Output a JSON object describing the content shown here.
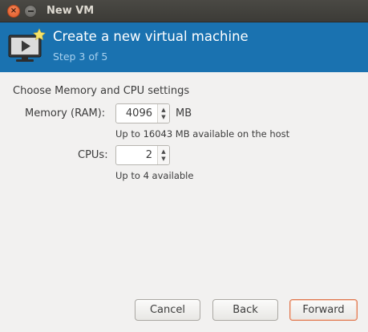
{
  "window": {
    "title": "New VM",
    "close_glyph": "×",
    "close_icon": "close-icon",
    "minimize_icon": "minimize-icon"
  },
  "header": {
    "icon": "virtual-machine-icon",
    "title": "Create a new virtual machine",
    "step": "Step 3 of 5",
    "background_color": "#1a72b0"
  },
  "settings": {
    "section_title": "Choose Memory and CPU settings",
    "memory": {
      "label": "Memory (RAM):",
      "value": "4096",
      "unit": "MB",
      "hint": "Up to 16043 MB available on the host"
    },
    "cpus": {
      "label": "CPUs:",
      "value": "2",
      "hint": "Up to 4 available"
    },
    "spin_up_glyph": "▲",
    "spin_down_glyph": "▼"
  },
  "buttons": {
    "cancel": "Cancel",
    "back": "Back",
    "forward": "Forward",
    "forward_border_color": "#e07a52"
  }
}
